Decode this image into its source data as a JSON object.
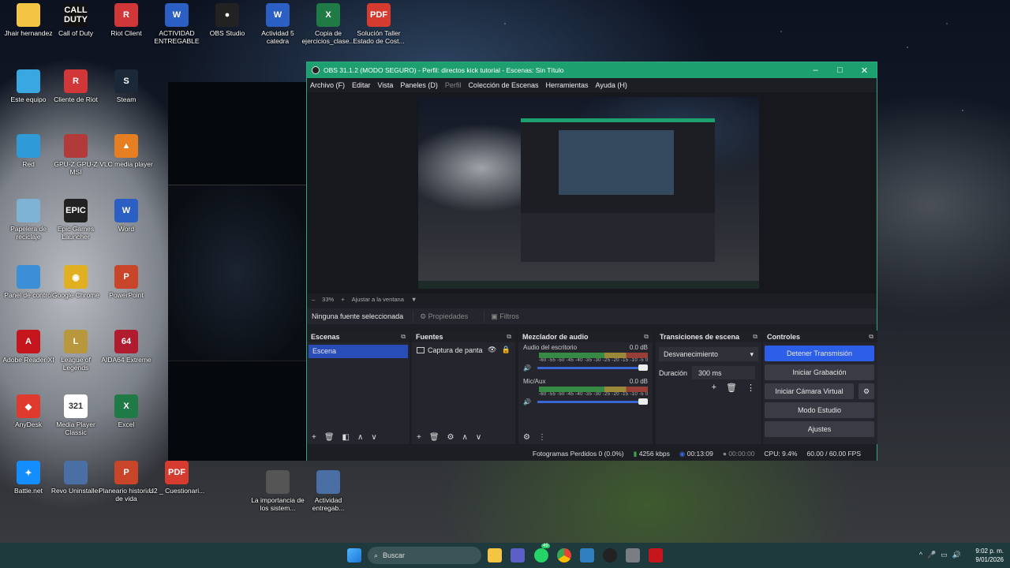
{
  "desktop_icons": [
    {
      "label": "Jhair hernandez",
      "glyph": "",
      "color": "#f4c542"
    },
    {
      "label": "Call of Duty",
      "glyph": "CALL DUTY",
      "color": "#111111"
    },
    {
      "label": "Riot Client",
      "glyph": "R",
      "color": "#d13639"
    },
    {
      "label": "ACTIVIDAD ENTREGABLE",
      "glyph": "W",
      "color": "#2b5fc4"
    },
    {
      "label": "OBS Studio",
      "glyph": "●",
      "color": "#222222"
    },
    {
      "label": "Actividad 5 catedra",
      "glyph": "W",
      "color": "#2b5fc4"
    },
    {
      "label": "Copia de ejercicios_clase...",
      "glyph": "X",
      "color": "#1f7a46"
    },
    {
      "label": "Solución Taller Estado de Cost...",
      "glyph": "PDF",
      "color": "#d63b2f"
    },
    {
      "label": "Este equipo",
      "glyph": "",
      "color": "#39a8e0"
    },
    {
      "label": "Cliente de Riot",
      "glyph": "R",
      "color": "#d13639"
    },
    {
      "label": "Steam",
      "glyph": "S",
      "color": "#1b2838"
    },
    {
      "label": "Red",
      "glyph": "",
      "color": "#2e9ad8"
    },
    {
      "label": "GPU-Z GPU-Z MSI",
      "glyph": "",
      "color": "#b33a3a"
    },
    {
      "label": "VLC media player",
      "glyph": "▲",
      "color": "#e67e22"
    },
    {
      "label": "Papelera de reciclaje",
      "glyph": "",
      "color": "#7fb3d5"
    },
    {
      "label": "Epic Games Launcher",
      "glyph": "EPIC",
      "color": "#222222"
    },
    {
      "label": "Word",
      "glyph": "W",
      "color": "#2b5fc4"
    },
    {
      "label": "Panel de control",
      "glyph": "",
      "color": "#3a8fd6"
    },
    {
      "label": "Google Chrome",
      "glyph": "◉",
      "color": "#e0b020"
    },
    {
      "label": "PowerPoint",
      "glyph": "P",
      "color": "#c9452a"
    },
    {
      "label": "Adobe Reader XI",
      "glyph": "A",
      "color": "#c4161c"
    },
    {
      "label": "League of Legends",
      "glyph": "L",
      "color": "#b8973d"
    },
    {
      "label": "AIDA64 Extreme",
      "glyph": "64",
      "color": "#b01c2e"
    },
    {
      "label": "AnyDesk",
      "glyph": "◆",
      "color": "#e0392d"
    },
    {
      "label": "Media Player Classic",
      "glyph": "321",
      "color": "#ffffff"
    },
    {
      "label": "Excel",
      "glyph": "X",
      "color": "#1f7a46"
    },
    {
      "label": "Battle.net",
      "glyph": "✦",
      "color": "#148eff"
    },
    {
      "label": "Revo Uninstaller",
      "glyph": "",
      "color": "#4a6fa5"
    },
    {
      "label": "Planeario historias de vida",
      "glyph": "P",
      "color": "#c9452a"
    },
    {
      "label": "U2 _ Cuestionari...",
      "glyph": "PDF",
      "color": "#d63b2f"
    },
    {
      "label": "La importancia de los sistem...",
      "glyph": "",
      "color": "#555555"
    },
    {
      "label": "Actividad entregab...",
      "glyph": "",
      "color": "#4a6fa5"
    }
  ],
  "obs": {
    "title": "OBS 31.1.2 (MODO SEGURO) - Perfil: directos kick tutorial - Escenas: Sin Título",
    "window_buttons": [
      "–",
      "□",
      "✕"
    ],
    "menu": [
      "Archivo (F)",
      "Editar",
      "Vista",
      "Paneles (D)",
      "Perfil",
      "Colección de Escenas",
      "Herramientas",
      "Ayuda (H)"
    ],
    "zoom": {
      "minus": "–",
      "value": "33%",
      "plus": "+",
      "fit": "Ajustar a la ventana",
      "arrow": "▼"
    },
    "source_bar": {
      "none": "Ninguna fuente seleccionada",
      "properties": "Propiedades",
      "filters": "Filtros"
    },
    "scenes": {
      "title": "Escenas",
      "items": [
        "Escena"
      ]
    },
    "sources": {
      "title": "Fuentes",
      "items": [
        "Captura de pantalla"
      ]
    },
    "mixer": {
      "title": "Mezclador de audio",
      "channels": [
        {
          "name": "Audio del escritorio",
          "db": "0.0 dB"
        },
        {
          "name": "Mic/Aux",
          "db": "0.0 dB"
        }
      ],
      "scale": "-60 -55 -50 -45 -40 -35 -30 -25 -20 -15 -10 -5 0"
    },
    "transitions": {
      "title": "Transiciones de escena",
      "selected": "Desvanecimiento",
      "duration_label": "Duración",
      "duration_value": "300 ms"
    },
    "controls": {
      "title": "Controles",
      "buttons": [
        "Detener Transmisión",
        "Iniciar Grabación",
        "Iniciar Cámara Virtual",
        "Modo Estudio",
        "Ajustes"
      ]
    },
    "status": {
      "dropped": "Fotogramas Perdidos 0 (0.0%)",
      "bitrate": "4256 kbps",
      "stream_time": "00:13:09",
      "rec_time": "00:00:00",
      "cpu": "CPU: 9.4%",
      "fps": "60.00 / 60.00 FPS"
    }
  },
  "taskbar": {
    "search_placeholder": "Buscar",
    "whatsapp_badge": "49",
    "time": "9:02 p. m.",
    "date": "9/01/2026"
  },
  "colors": {
    "obs_accent": "#1d9f6f",
    "primary_button": "#2d5ee8",
    "selected_scene": "#284cb8"
  }
}
